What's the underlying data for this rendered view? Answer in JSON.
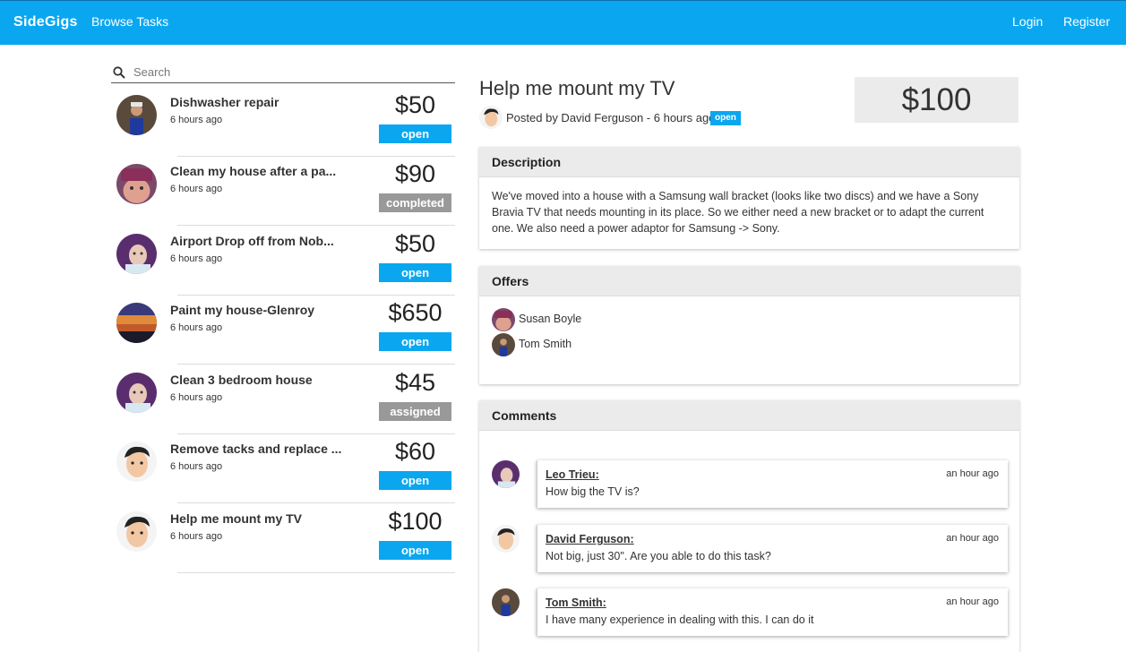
{
  "nav": {
    "brand": "SideGigs",
    "browse": "Browse Tasks",
    "login": "Login",
    "register": "Register"
  },
  "search": {
    "placeholder": "Search",
    "icon": "search-icon"
  },
  "colors": {
    "brand_blue": "#0aa7f0",
    "status_gray": "#999999",
    "price_bg": "#ebebeb"
  },
  "tasks": [
    {
      "title": "Dishwasher repair",
      "time": "6 hours ago",
      "price": "$50",
      "status": "open"
    },
    {
      "title": "Clean my house after a pa...",
      "time": "6 hours ago",
      "price": "$90",
      "status": "completed"
    },
    {
      "title": "Airport Drop off from Nob...",
      "time": "6 hours ago",
      "price": "$50",
      "status": "open"
    },
    {
      "title": "Paint my house-Glenroy",
      "time": "6 hours ago",
      "price": "$650",
      "status": "open"
    },
    {
      "title": "Clean 3 bedroom house",
      "time": "6 hours ago",
      "price": "$45",
      "status": "assigned"
    },
    {
      "title": "Remove tacks and replace ...",
      "time": "6 hours ago",
      "price": "$60",
      "status": "open"
    },
    {
      "title": "Help me mount my TV",
      "time": "6 hours ago",
      "price": "$100",
      "status": "open"
    }
  ],
  "detail": {
    "title": "Help me mount my TV",
    "posted": "Posted by David Ferguson - 6 hours ago",
    "status": "open",
    "price": "$100",
    "description_heading": "Description",
    "description": "We've moved into a house with a Samsung wall bracket (looks like two discs) and we have a Sony Bravia TV that needs mounting in its place. So we either need a new bracket or to adapt the current one. We also need a power adaptor for Samsung -> Sony.",
    "offers_heading": "Offers",
    "offers": [
      {
        "name": "Susan Boyle"
      },
      {
        "name": "Tom Smith"
      }
    ],
    "comments_heading": "Comments",
    "comments": [
      {
        "author": "Leo Trieu:",
        "time": "an hour ago",
        "text": "How big the TV is?"
      },
      {
        "author": "David Ferguson:",
        "time": "an hour ago",
        "text": "Not big, just 30\". Are you able to do this task?"
      },
      {
        "author": "Tom Smith:",
        "time": "an hour ago",
        "text": "I have many experience in dealing with this. I can do it"
      }
    ]
  }
}
